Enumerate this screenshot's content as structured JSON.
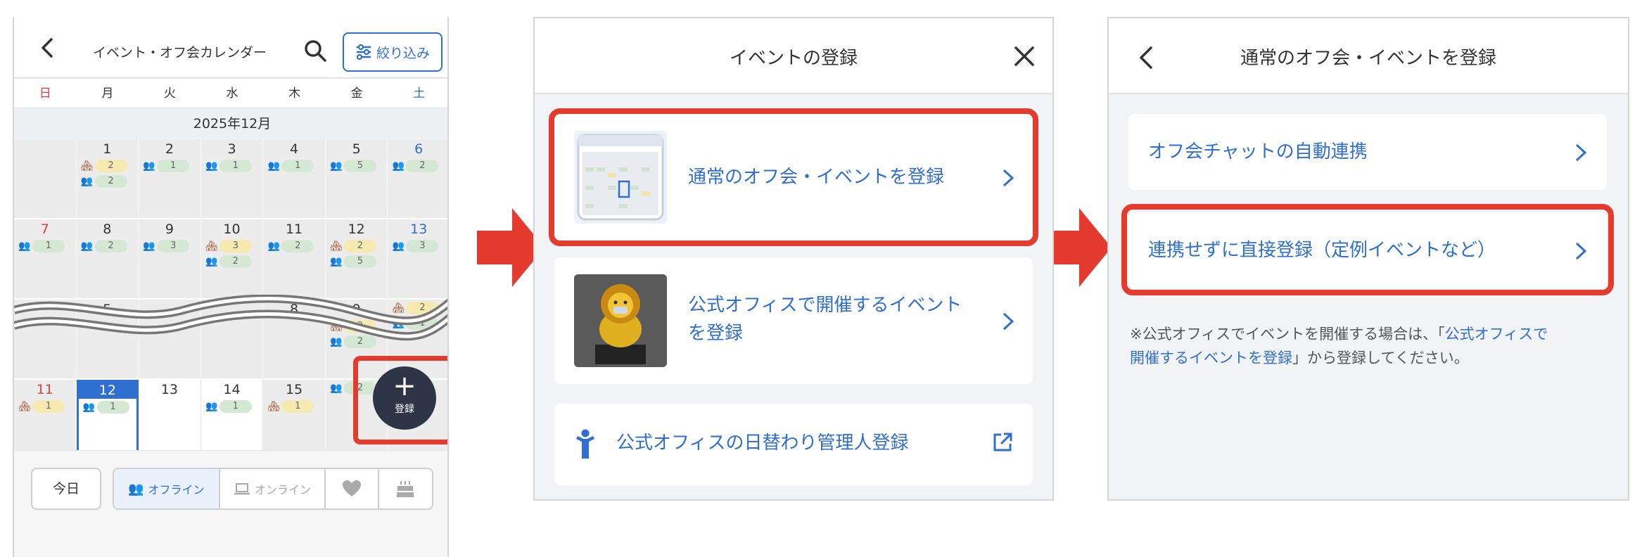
{
  "calendar": {
    "title": "イベント・オフ会カレンダー",
    "filter_label": "絞り込み",
    "weekdays": [
      "日",
      "月",
      "火",
      "水",
      "木",
      "金",
      "土"
    ],
    "month": "2025年12月",
    "rows": [
      [
        {
          "d": "",
          "events": []
        },
        {
          "d": "1",
          "events": [
            {
              "i": "house",
              "n": "2",
              "c": "y"
            },
            {
              "i": "people",
              "n": "2",
              "c": "g"
            }
          ]
        },
        {
          "d": "2",
          "events": [
            {
              "i": "people",
              "n": "1",
              "c": "g"
            }
          ]
        },
        {
          "d": "3",
          "events": [
            {
              "i": "people",
              "n": "1",
              "c": "g"
            }
          ]
        },
        {
          "d": "4",
          "events": [
            {
              "i": "people",
              "n": "1",
              "c": "g"
            }
          ]
        },
        {
          "d": "5",
          "events": [
            {
              "i": "people",
              "n": "5",
              "c": "g"
            }
          ]
        },
        {
          "d": "6",
          "events": [
            {
              "i": "people",
              "n": "2",
              "c": "g"
            }
          ]
        }
      ],
      [
        {
          "d": "7",
          "events": [
            {
              "i": "people",
              "n": "1",
              "c": "g"
            }
          ]
        },
        {
          "d": "8",
          "events": [
            {
              "i": "people",
              "n": "2",
              "c": "g"
            }
          ]
        },
        {
          "d": "9",
          "events": [
            {
              "i": "people",
              "n": "3",
              "c": "g"
            }
          ]
        },
        {
          "d": "10",
          "events": [
            {
              "i": "house",
              "n": "3",
              "c": "y"
            },
            {
              "i": "people",
              "n": "2",
              "c": "g"
            }
          ]
        },
        {
          "d": "11",
          "events": [
            {
              "i": "people",
              "n": "2",
              "c": "g"
            }
          ]
        },
        {
          "d": "12",
          "events": [
            {
              "i": "house",
              "n": "2",
              "c": "y"
            },
            {
              "i": "people",
              "n": "5",
              "c": "g"
            }
          ]
        },
        {
          "d": "13",
          "events": [
            {
              "i": "people",
              "n": "3",
              "c": "g"
            }
          ]
        }
      ],
      [
        {
          "d": "",
          "events": []
        },
        {
          "d": "5",
          "events": []
        },
        {
          "d": "",
          "events": []
        },
        {
          "d": "",
          "events": []
        },
        {
          "d": "8",
          "events": []
        },
        {
          "d": "9",
          "events": [
            {
              "i": "house",
              "n": "2",
              "c": "y"
            },
            {
              "i": "people",
              "n": "2",
              "c": "g"
            }
          ]
        },
        {
          "d": "",
          "events": [
            {
              "i": "house",
              "n": "2",
              "c": "y"
            },
            {
              "i": "people",
              "n": "1",
              "c": "g"
            }
          ]
        }
      ],
      [
        {
          "d": "11",
          "events": [
            {
              "i": "house",
              "n": "1",
              "c": "y"
            }
          ]
        },
        {
          "d": "12",
          "events": [
            {
              "i": "people",
              "n": "1",
              "c": "g"
            }
          ]
        },
        {
          "d": "13",
          "events": []
        },
        {
          "d": "14",
          "events": [
            {
              "i": "people",
              "n": "1",
              "c": "g"
            }
          ]
        },
        {
          "d": "15",
          "events": [
            {
              "i": "house",
              "n": "1",
              "c": "y"
            }
          ]
        },
        {
          "d": "",
          "events": [
            {
              "i": "people",
              "n": "2",
              "c": "g"
            }
          ]
        },
        {
          "d": "",
          "events": []
        }
      ]
    ],
    "fab_label": "登録",
    "today_label": "今日",
    "segments": [
      "オフライン",
      "オンライン",
      "",
      ""
    ]
  },
  "dialog": {
    "title": "イベントの登録",
    "option1": "通常のオフ会・イベントを登録",
    "option2_line1": "公式オフィスで開催するイベント",
    "option2_line2": "を登録",
    "option3": "公式オフィスの日替わり管理人登録"
  },
  "register": {
    "title": "通常のオフ会・イベントを登録",
    "option1": "オフ会チャットの自動連携",
    "option2": "連携せずに直接登録（定例イベントなど）",
    "note_part1": "※公式オフィスでイベントを開催する場合は、「",
    "note_link1": "公式オフィスで",
    "note_link2": "開催するイベントを登録",
    "note_part2": "」から登録してください。"
  },
  "colors": {
    "accent": "#2f6fd0",
    "highlight": "#e53b2f",
    "fab": "#2e3547",
    "sunday": "#d94040"
  }
}
